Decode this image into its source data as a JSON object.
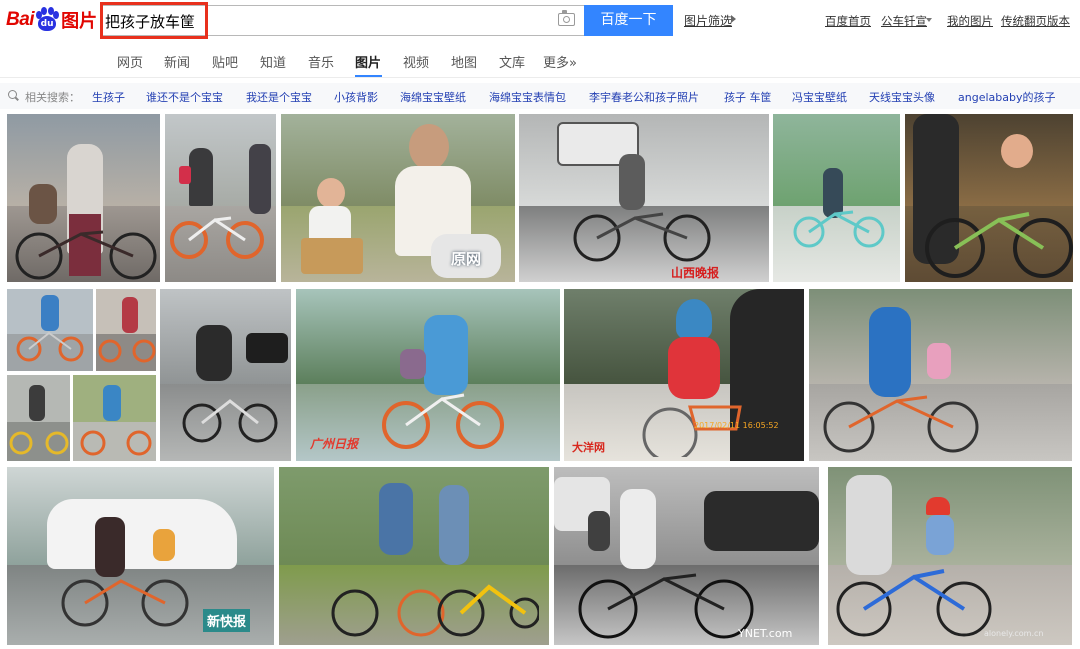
{
  "logo": {
    "bai": "Bai",
    "du": "du",
    "tu": "图片"
  },
  "search": {
    "query": "把孩子放车筐",
    "button_label": "百度一下",
    "filter_label": "图片筛选"
  },
  "toplinks": [
    "百度首页",
    "公车钎宣",
    "我的图片",
    "传统翻页版本"
  ],
  "tabs": [
    "网页",
    "新闻",
    "贴吧",
    "知道",
    "音乐",
    "图片",
    "视频",
    "地图",
    "文库",
    "更多»"
  ],
  "active_tab": "图片",
  "related": {
    "label": "相关搜索：",
    "terms": [
      "生孩子",
      "谁还不是个宝宝",
      "我还是个宝宝",
      "小孩背影",
      "海绵宝宝壁纸",
      "海绵宝宝表情包",
      "李宇春老公和孩子照片",
      "孩子 车筐",
      "冯宝宝壁纸",
      "天线宝宝头像",
      "angelababy的孩子"
    ]
  },
  "watermarks": {
    "w1": "原网",
    "w2": "山西晚报",
    "w3": "广州日报",
    "w4": "大洋网",
    "w5": "2017/02/11 16:05:52",
    "w6": "新快报",
    "w7": "YNET.com",
    "w8": "alonely.com.cn"
  },
  "colors": {
    "brand_red": "#e10601",
    "brand_blue": "#2932e1",
    "button_blue": "#3385ff",
    "highlight_red": "#e8301d",
    "link_blue": "#2440b3"
  },
  "icons": [
    "camera-icon",
    "magnifier-icon",
    "paw-icon"
  ]
}
